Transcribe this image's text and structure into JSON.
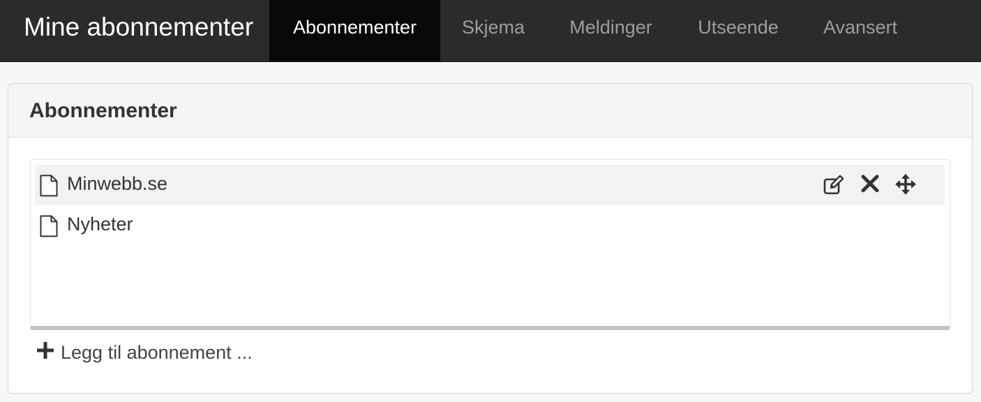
{
  "app": {
    "brand": "Mine abonnementer"
  },
  "nav": {
    "tabs": [
      {
        "label": "Abonnementer",
        "active": true
      },
      {
        "label": "Skjema",
        "active": false
      },
      {
        "label": "Meldinger",
        "active": false
      },
      {
        "label": "Utseende",
        "active": false
      },
      {
        "label": "Avansert",
        "active": false
      }
    ]
  },
  "panel": {
    "title": "Abonnementer",
    "items": [
      {
        "label": "Minwebb.se",
        "icon": "file-icon",
        "hovered": true,
        "actions": [
          "edit-icon",
          "remove-icon",
          "move-icon"
        ]
      },
      {
        "label": "Nyheter",
        "icon": "file-icon",
        "hovered": false
      }
    ],
    "add_label": "Legg til abonnement ..."
  },
  "colors": {
    "navbar_bg": "#2b2b2b",
    "active_tab_bg": "#080808",
    "inactive_tab_text": "#9d9d9d",
    "hover_row_bg": "#f2f2f2"
  }
}
